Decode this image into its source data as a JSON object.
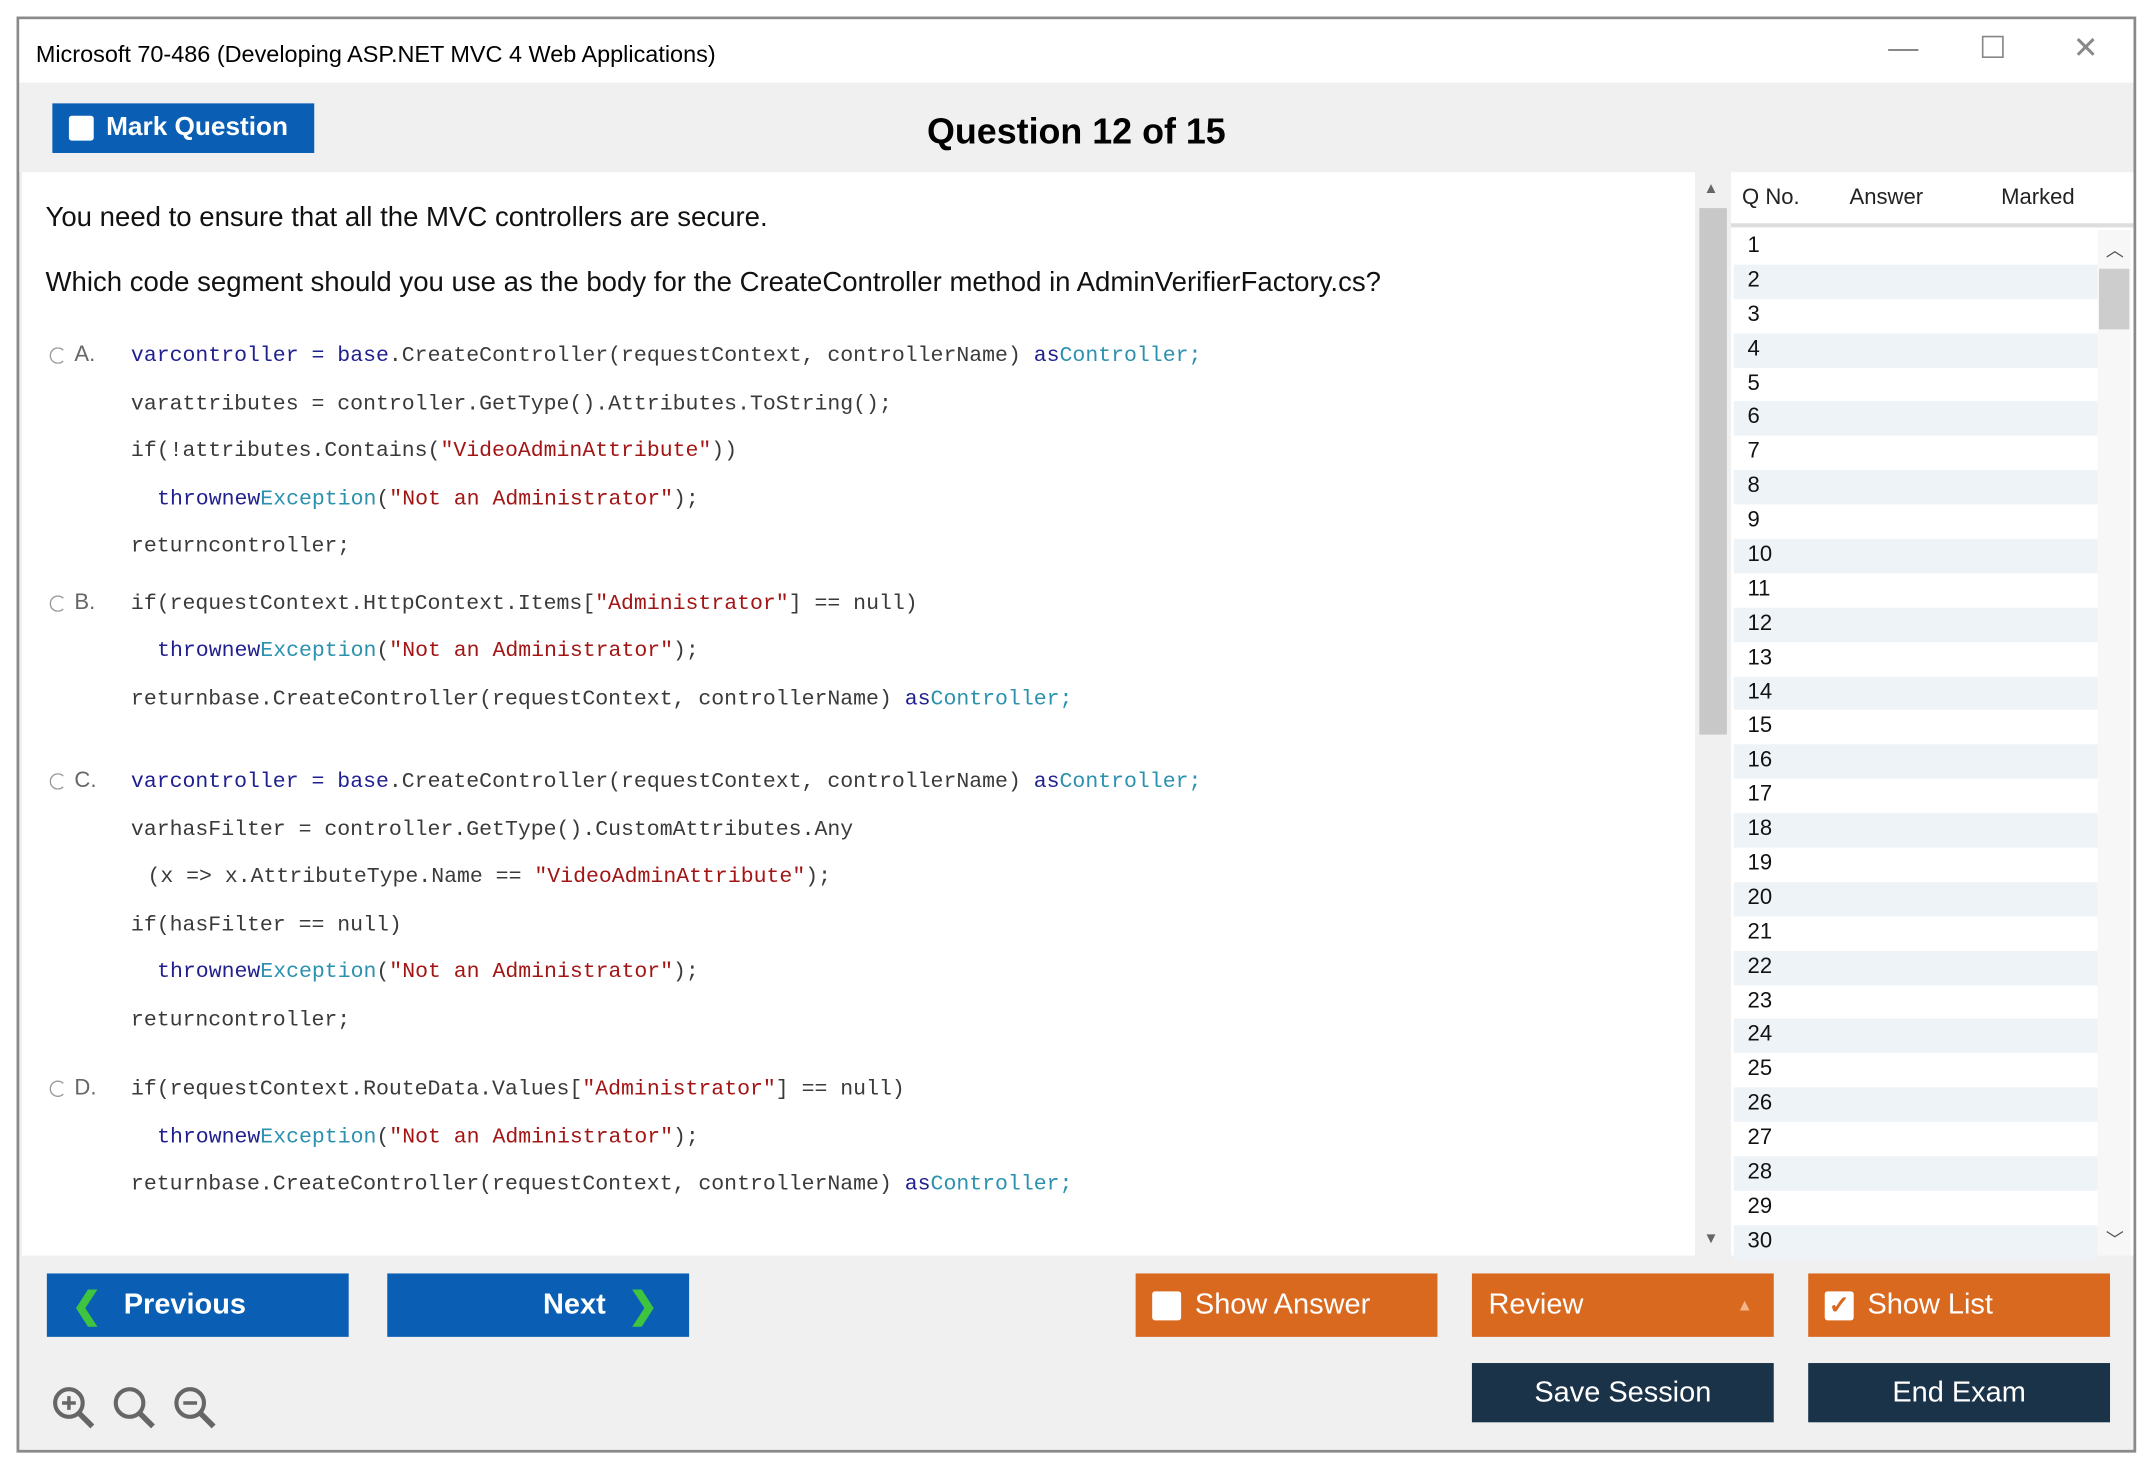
{
  "window": {
    "title": "Microsoft 70-486 (Developing ASP.NET MVC 4 Web Applications)",
    "minimize": "—",
    "maximize": "☐",
    "close": "✕"
  },
  "header": {
    "mark_label": "Mark Question",
    "question_title": "Question 12 of 15"
  },
  "question": {
    "line1": "You need to ensure that all the MVC controllers are secure.",
    "line2": "Which code segment should you use as the body for the CreateController method in AdminVerifierFactory.cs?"
  },
  "options": [
    {
      "letter": "A.",
      "lines": [
        {
          "indent": 0,
          "segs": [
            [
              "varcontroller = ",
              "k"
            ],
            [
              "base",
              "k"
            ],
            [
              ".CreateController(requestContext, controllerName) ",
              ""
            ],
            [
              "as",
              "k"
            ],
            [
              "Controller;",
              "t"
            ]
          ]
        },
        {
          "indent": 0,
          "segs": [
            [
              "varattributes = controller.GetType().Attributes.ToString();",
              ""
            ]
          ]
        },
        {
          "indent": 0,
          "segs": [
            [
              "if(!attributes.Contains(",
              ""
            ],
            [
              "\"VideoAdminAttribute\"",
              "s"
            ],
            [
              "))",
              ""
            ]
          ]
        },
        {
          "indent": 1,
          "segs": [
            [
              "thrownew",
              "k"
            ],
            [
              "Exception",
              "t"
            ],
            [
              "(",
              ""
            ],
            [
              "\"Not an Administrator\"",
              "s"
            ],
            [
              ");",
              ""
            ]
          ]
        },
        {
          "indent": 0,
          "segs": [
            [
              "returncontroller;",
              ""
            ]
          ]
        }
      ]
    },
    {
      "letter": "B.",
      "lines": [
        {
          "indent": 0,
          "segs": [
            [
              "if(requestContext.HttpContext.Items[",
              ""
            ],
            [
              "\"Administrator\"",
              "s"
            ],
            [
              "] == null)",
              ""
            ]
          ]
        },
        {
          "indent": 1,
          "segs": [
            [
              "thrownew",
              "k"
            ],
            [
              "Exception",
              "t"
            ],
            [
              "(",
              ""
            ],
            [
              "\"Not an Administrator\"",
              "s"
            ],
            [
              ");",
              ""
            ]
          ]
        },
        {
          "indent": 0,
          "segs": [
            [
              "returnbase.CreateController(requestContext, controllerName) ",
              ""
            ],
            [
              "as",
              "k"
            ],
            [
              "Controller;",
              "t"
            ]
          ]
        }
      ]
    },
    {
      "letter": "C.",
      "lines": [
        {
          "indent": 0,
          "segs": [
            [
              "varcontroller = ",
              "k"
            ],
            [
              "base",
              "k"
            ],
            [
              ".CreateController(requestContext, controllerName) ",
              ""
            ],
            [
              "as",
              "k"
            ],
            [
              "Controller;",
              "t"
            ]
          ]
        },
        {
          "indent": 0,
          "segs": [
            [
              "varhasFilter = controller.GetType().CustomAttributes.Any",
              ""
            ]
          ]
        },
        {
          "indent": 2,
          "segs": [
            [
              "(x => x.AttributeType.Name == ",
              ""
            ],
            [
              "\"VideoAdminAttribute\"",
              "s"
            ],
            [
              ");",
              ""
            ]
          ]
        },
        {
          "indent": 0,
          "segs": [
            [
              "if(hasFilter == null)",
              ""
            ]
          ]
        },
        {
          "indent": 1,
          "segs": [
            [
              "thrownew",
              "k"
            ],
            [
              "Exception",
              "t"
            ],
            [
              "(",
              ""
            ],
            [
              "\"Not an Administrator\"",
              "s"
            ],
            [
              ");",
              ""
            ]
          ]
        },
        {
          "indent": 0,
          "segs": [
            [
              "returncontroller;",
              ""
            ]
          ]
        }
      ]
    },
    {
      "letter": "D.",
      "lines": [
        {
          "indent": 0,
          "segs": [
            [
              "if(requestContext.RouteData.Values[",
              ""
            ],
            [
              "\"Administrator\"",
              "s"
            ],
            [
              "] == null)",
              ""
            ]
          ]
        },
        {
          "indent": 1,
          "segs": [
            [
              "thrownew",
              "k"
            ],
            [
              "Exception",
              "t"
            ],
            [
              "(",
              ""
            ],
            [
              "\"Not an Administrator\"",
              "s"
            ],
            [
              ");",
              ""
            ]
          ]
        },
        {
          "indent": 0,
          "segs": [
            [
              "returnbase.CreateController(requestContext, controllerName) ",
              ""
            ],
            [
              "as",
              "k"
            ],
            [
              "Controller;",
              "t"
            ]
          ]
        }
      ]
    }
  ],
  "panel": {
    "col_qno": "Q No.",
    "col_answer": "Answer",
    "col_marked": "Marked",
    "rows": [
      "1",
      "2",
      "3",
      "4",
      "5",
      "6",
      "7",
      "8",
      "9",
      "10",
      "11",
      "12",
      "13",
      "14",
      "15",
      "16",
      "17",
      "18",
      "19",
      "20",
      "21",
      "22",
      "23",
      "24",
      "25",
      "26",
      "27",
      "28",
      "29",
      "30"
    ]
  },
  "footer": {
    "previous": "Previous",
    "next": "Next",
    "show_answer": "Show Answer",
    "review": "Review",
    "show_list": "Show List",
    "save_session": "Save Session",
    "end_exam": "End Exam"
  },
  "colors": {
    "blue": "#0a5fb4",
    "orange": "#d9691e",
    "navy": "#1b3349"
  }
}
